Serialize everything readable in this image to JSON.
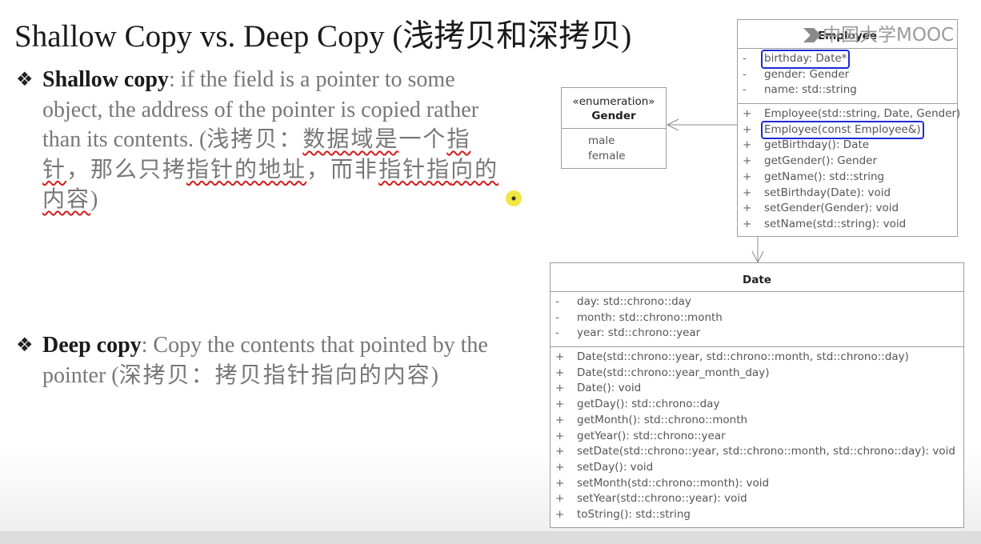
{
  "slide": {
    "title": "Shallow Copy vs. Deep Copy (浅拷贝和深拷贝)",
    "bullets": [
      {
        "term": "Shallow copy",
        "text": ": if the field is a pointer to some object, the address of the pointer is copied rather than its contents. (",
        "cn_a": "浅拷贝：",
        "cn_b": "数据域是",
        "cn_c": "一个",
        "cn_d": "指针",
        "cn_e": "，那么只拷",
        "cn_f": "指针的地址",
        "cn_g": "，而非",
        "cn_h": "指针指",
        "cn_i": "向的内容",
        "close": ")"
      },
      {
        "term": "Deep copy",
        "text": ": Copy the contents that pointed by the pointer (",
        "cn": "深拷贝：拷贝指针指向的内容",
        "close": ")"
      }
    ]
  },
  "watermark": "中国大学MOOC",
  "uml": {
    "employee": {
      "name": "Employee",
      "attributes": [
        {
          "vis": "-",
          "text": "birthday: Date*"
        },
        {
          "vis": "-",
          "text": "gender: Gender"
        },
        {
          "vis": "-",
          "text": "name: std::string"
        }
      ],
      "operations": [
        {
          "vis": "+",
          "text": "Employee(std::string, Date, Gender)"
        },
        {
          "vis": "+",
          "text": "Employee(const Employee&)"
        },
        {
          "vis": "+",
          "text": "getBirthday(): Date"
        },
        {
          "vis": "+",
          "text": "getGender(): Gender"
        },
        {
          "vis": "+",
          "text": "getName(): std::string"
        },
        {
          "vis": "+",
          "text": "setBirthday(Date): void"
        },
        {
          "vis": "+",
          "text": "setGender(Gender): void"
        },
        {
          "vis": "+",
          "text": "setName(std::string): void"
        }
      ]
    },
    "gender": {
      "stereotype": "«enumeration»",
      "name": "Gender",
      "values": [
        "male",
        "female"
      ]
    },
    "date": {
      "name": "Date",
      "attributes": [
        {
          "vis": "-",
          "text": "day: std::chrono::day"
        },
        {
          "vis": "-",
          "text": "month: std::chrono::month"
        },
        {
          "vis": "-",
          "text": "year: std::chrono::year"
        }
      ],
      "operations": [
        {
          "vis": "+",
          "text": "Date(std::chrono::year, std::chrono::month, std::chrono::day)"
        },
        {
          "vis": "+",
          "text": "Date(std::chrono::year_month_day)"
        },
        {
          "vis": "+",
          "text": "Date(): void"
        },
        {
          "vis": "+",
          "text": "getDay(): std::chrono::day"
        },
        {
          "vis": "+",
          "text": "getMonth(): std::chrono::month"
        },
        {
          "vis": "+",
          "text": "getYear(): std::chrono::year"
        },
        {
          "vis": "+",
          "text": "setDate(std::chrono::year, std::chrono::month, std::chrono::day): void"
        },
        {
          "vis": "+",
          "text": "setDay(): void"
        },
        {
          "vis": "+",
          "text": "setMonth(std::chrono::month): void"
        },
        {
          "vis": "+",
          "text": "setYear(std::chrono::year): void"
        },
        {
          "vis": "+",
          "text": "toString(): std::string"
        }
      ]
    }
  },
  "colors": {
    "highlight_box": "#1c2bd6",
    "underline": "#d21c1c",
    "body_text": "#777777"
  }
}
